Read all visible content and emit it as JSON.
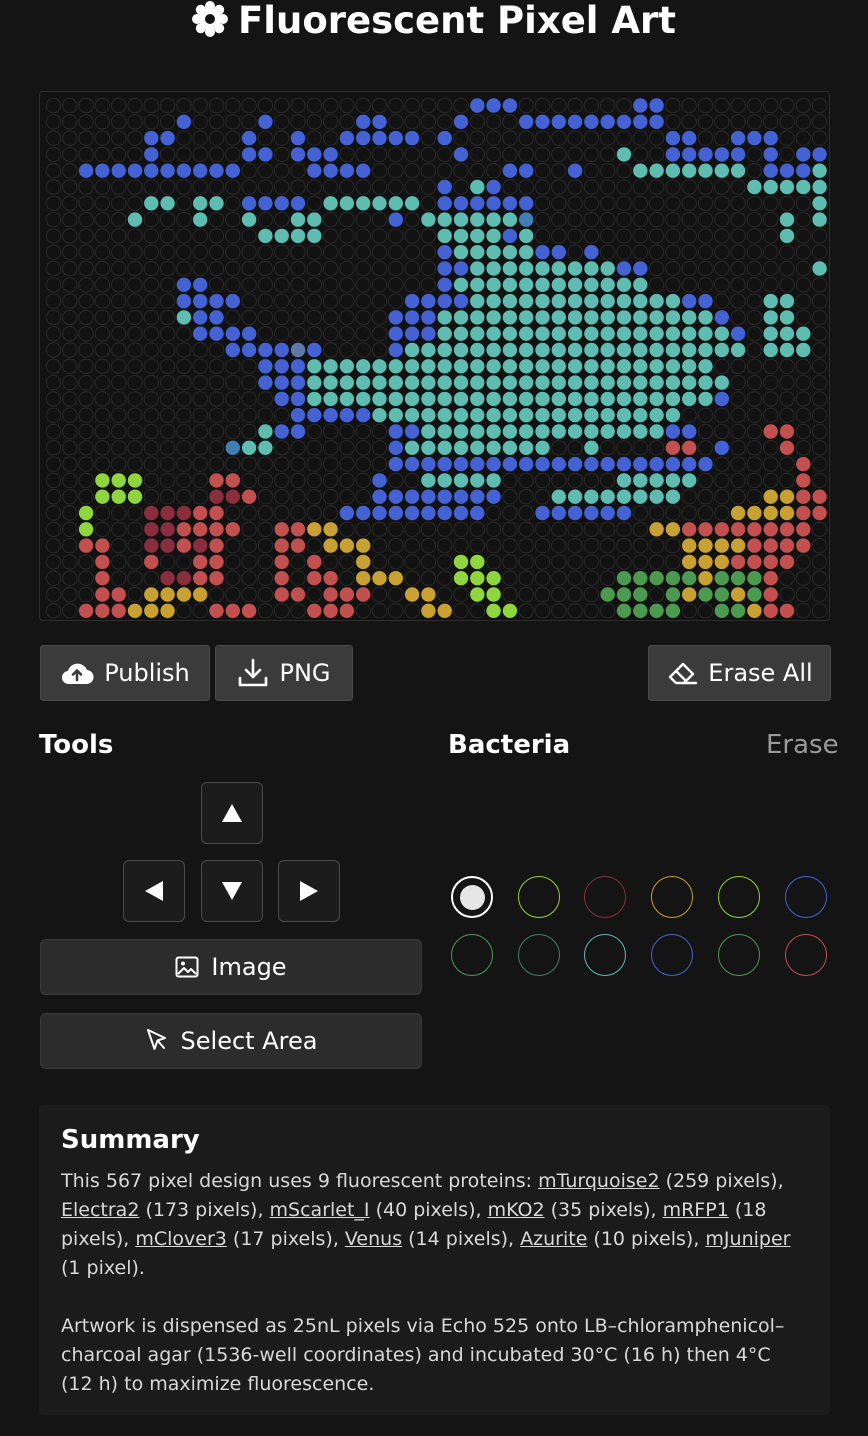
{
  "header": {
    "title": "Fluorescent Pixel Art",
    "icon": "gear-flower-icon"
  },
  "board": {
    "cols": 48,
    "rows": 32,
    "empty_color": "#2a2a2a",
    "palette": {
      "B": "#4462d4",
      "T": "#5fbcb0",
      "R": "#c2504f",
      "D": "#8a2d3d",
      "Y": "#c9a132",
      "L": "#8fd63e",
      "G": "#4c9a50",
      "C": "#3f7fb4",
      "S": "#5d7aa8"
    },
    "pixels": [
      "..........................BBB.......BB..........",
      "........B....B.....BB....B...BBBBBBBBB..........",
      "......BB....B..B..BBBBB.B.............BB..BBB...",
      "......B.....BB.BBB.......B.........T..BBBBB.B.BB",
      "..BBBBBBBBBB....BBBB........BB..B...TTTTTTT.BBBT",
      "........................B.TB...............TTTTT",
      "......TT.TT.BBBB.TTTTTT.BBBBBB.................T",
      ".....T...T..T..TT....B.TTTTTTC...............T.T",
      ".............TTTT.......TTTTBT...............T..",
      "........................BTTTTTBB.B..............",
      "........................BBTTTTTTTTTBB..........T",
      "........BB..............BTTTTTTTTTTTT...........",
      "........BBBB..........BBBBTTTTTTTTTTTTTBB...TT..",
      "........TBB..........BBBTTTTTTTTTTTTTTTTTB..TT..",
      ".........BBBB........BBBTTTTTTTTTTTTTTTTTTB.TTT.",
      "...........BBBBSB....BTTTTTTTTTTTTTTTTTTTTT.TTT.",
      ".............BBBTTTTTTTTTTTTTTTTTTTTTTTTT.......",
      ".............BBBTTTTTTTTTTTTTTTTTTTTTTTTTT......",
      "..............BBTTTTTTTTTTTTTTTTTTTTTTTTTB......",
      "...............BBBBBTTTTTTTTTTTTTTTTTTT.........",
      ".............TBB.....BBTTTTTTTTTTTTTTTBB....RR..",
      "...........CTT.......BTTTTTTTTT..T....RR.B...R..",
      ".....................BBBBBBBBBBBBBBBBBBBB.....R.",
      "...LLL....RR........B..TTTTT.......TTTTT......R.",
      "...LLL....DDR.......BBBBBBBB...TTTTTTTT.....YYRR",
      "..L...DDDRR.......BBBBBBBBB...BBBBBB......YYYYRR",
      "..L...DDRRRR..RRYY...................YYRRRRRRRR.",
      "..RR..DDRDR...RR.YYY...................YYYYRRRR.",
      "...R..R..RR...R.R..Y.....LL............YYYRRRR.",
      "...R...DDRR...R.RR.YYY...LLL.......GGGGGYGGGR...",
      "...RR.YYYY....RR.RRR..YY..LL......GGG.GYGGYGR...",
      "..RRRYYY..RRR...RRR....YY..LL......GGGG..GGYRR.."
    ]
  },
  "actions": {
    "publish_label": "Publish",
    "png_label": "PNG",
    "erase_all_label": "Erase All"
  },
  "tools": {
    "heading": "Tools",
    "image_label": "Image",
    "select_area_label": "Select Area"
  },
  "bacteria": {
    "heading": "Bacteria",
    "erase_label": "Erase",
    "swatches": [
      {
        "color": "#e6e6e6",
        "selected": true
      },
      {
        "color": "#8fd63e"
      },
      {
        "color": "#8a2d3d"
      },
      {
        "color": "#c9a132"
      },
      {
        "color": "#8fd63e"
      },
      {
        "color": "#4462d4"
      },
      {
        "color": "#4c9a50"
      },
      {
        "color": "#3f7f6a"
      },
      {
        "color": "#5fbcb0"
      },
      {
        "color": "#4462d4"
      },
      {
        "color": "#4c9a50"
      },
      {
        "color": "#c2504f"
      }
    ]
  },
  "summary": {
    "heading": "Summary",
    "intro": "This 567 pixel design uses 9 fluorescent proteins: ",
    "proteins": [
      {
        "name": "mTurquoise2",
        "count": "(259 pixels)"
      },
      {
        "name": "Electra2",
        "count": "(173 pixels)"
      },
      {
        "name": "mScarlet_I",
        "count": "(40 pixels)"
      },
      {
        "name": "mKO2",
        "count": "(35 pixels)"
      },
      {
        "name": "mRFP1",
        "count": "(18 pixels)"
      },
      {
        "name": "mClover3",
        "count": "(17 pixels)"
      },
      {
        "name": "Venus",
        "count": "(14 pixels)"
      },
      {
        "name": "Azurite",
        "count": "(10 pixels)"
      },
      {
        "name": "mJuniper",
        "count": "(1 pixel)"
      }
    ],
    "protocol": "Artwork is dispensed as 25nL pixels via Echo 525 onto LB–chloramphenicol–charcoal agar (1536-well coordinates) and incubated 30°C (16 h) then 4°C (12 h) to maximize fluorescence."
  }
}
